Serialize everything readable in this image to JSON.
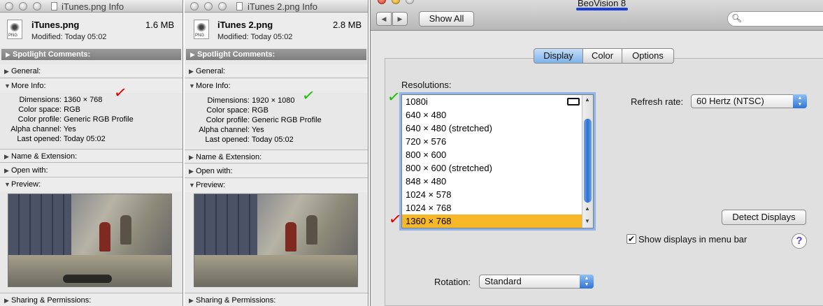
{
  "info_windows": [
    {
      "title": "iTunes.png Info",
      "file_name": "iTunes.png",
      "file_size": "1.6 MB",
      "modified": "Modified: Today 05:02",
      "sections": {
        "spotlight": "Spotlight Comments:",
        "general": "General:",
        "more_info": "More Info:",
        "name_ext": "Name & Extension:",
        "open_with": "Open with:",
        "preview": "Preview:",
        "sharing": "Sharing & Permissions:"
      },
      "more_info": {
        "dimensions_label": "Dimensions:",
        "dimensions_value": "1360 × 768",
        "color_space_label": "Color space:",
        "color_space_value": "RGB",
        "color_profile_label": "Color profile:",
        "color_profile_value": "Generic RGB Profile",
        "alpha_label": "Alpha channel:",
        "alpha_value": "Yes",
        "last_opened_label": "Last opened:",
        "last_opened_value": "Today 05:02"
      },
      "check_mark": "✓",
      "check_color": "#e00000"
    },
    {
      "title": "iTunes 2.png Info",
      "file_name": "iTunes 2.png",
      "file_size": "2.8 MB",
      "modified": "Modified: Today 05:02",
      "sections": {
        "spotlight": "Spotlight Comments:",
        "general": "General:",
        "more_info": "More Info:",
        "name_ext": "Name & Extension:",
        "open_with": "Open with:",
        "preview": "Preview:",
        "sharing": "Sharing & Permissions:"
      },
      "more_info": {
        "dimensions_label": "Dimensions:",
        "dimensions_value": "1920 × 1080",
        "color_space_label": "Color space:",
        "color_space_value": "RGB",
        "color_profile_label": "Color profile:",
        "color_profile_value": "Generic RGB Profile",
        "alpha_label": "Alpha channel:",
        "alpha_value": "Yes",
        "last_opened_label": "Last opened:",
        "last_opened_value": "Today 05:02"
      },
      "check_mark": "✓",
      "check_color": "#18c000"
    }
  ],
  "prefs": {
    "title": "BeoVision 8",
    "show_all": "Show All",
    "tabs": [
      "Display",
      "Color",
      "Options"
    ],
    "active_tab": "Display",
    "resolutions_label": "Resolutions:",
    "resolutions": [
      "1080i",
      "640 × 480",
      "640 × 480 (stretched)",
      "720 × 576",
      "800 × 600",
      "800 × 600 (stretched)",
      "848 × 480",
      "1024 × 578",
      "1024 × 768",
      "1360 × 768"
    ],
    "selected_resolution": "1360 × 768",
    "refresh_label": "Refresh rate:",
    "refresh_value": "60 Hertz (NTSC)",
    "detect_button": "Detect Displays",
    "show_in_menu_bar": "Show displays in menu bar",
    "show_in_menu_bar_checked": true,
    "rotation_label": "Rotation:",
    "rotation_value": "Standard",
    "help": "?",
    "green_check": "✓",
    "red_check": "✓"
  },
  "colors": {
    "accent_blue": "#2f74d8",
    "selection_orange": "#f6b828",
    "red_mark": "#e00000",
    "green_mark": "#18c000"
  }
}
